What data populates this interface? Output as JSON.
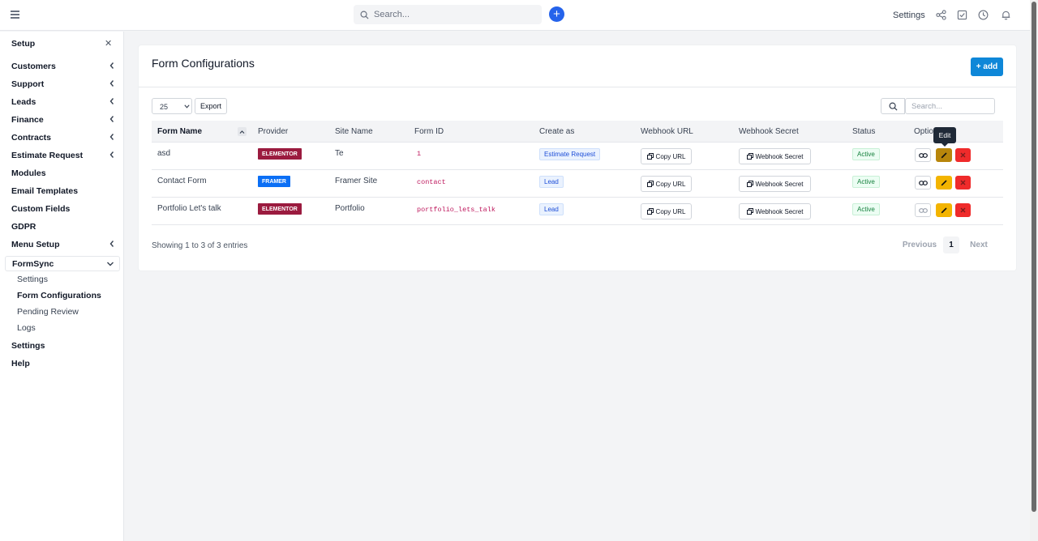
{
  "topbar": {
    "search_placeholder": "Search...",
    "settings_label": "Settings"
  },
  "sidebar": {
    "header": "Setup",
    "items": [
      {
        "label": "Customers",
        "chevron": true
      },
      {
        "label": "Support",
        "chevron": true
      },
      {
        "label": "Leads",
        "chevron": true
      },
      {
        "label": "Finance",
        "chevron": true
      },
      {
        "label": "Contracts",
        "chevron": true
      },
      {
        "label": "Estimate Request",
        "chevron": true
      },
      {
        "label": "Modules",
        "chevron": false
      },
      {
        "label": "Email Templates",
        "chevron": false
      },
      {
        "label": "Custom Fields",
        "chevron": false
      },
      {
        "label": "GDPR",
        "chevron": false
      },
      {
        "label": "Menu Setup",
        "chevron": true
      }
    ],
    "active_group": "FormSync",
    "sub_items": [
      "Settings",
      "Form Configurations",
      "Pending Review",
      "Logs"
    ],
    "bottom_items": [
      "Settings",
      "Help"
    ]
  },
  "page": {
    "title": "Form Configurations",
    "add_label": "add",
    "page_length": "25",
    "export_label": "Export",
    "search_placeholder": "Search...",
    "showing_text": "Showing 1 to 3 of 3 entries",
    "pagination": {
      "previous": "Previous",
      "current": "1",
      "next": "Next"
    },
    "tooltip": "Edit"
  },
  "table": {
    "columns": [
      "Form Name",
      "Provider",
      "Site Name",
      "Form ID",
      "Create as",
      "Webhook URL",
      "Webhook Secret",
      "Status",
      "Options"
    ],
    "copy_url_label": "Copy URL",
    "webhook_secret_label": "Webhook Secret",
    "rows": [
      {
        "form_name": "asd",
        "provider": "ELEMENTOR",
        "provider_color": "#9b1b3f",
        "site_name": "Te",
        "form_id": "1",
        "create_as": "Estimate Request",
        "status": "Active"
      },
      {
        "form_name": "Contact Form",
        "provider": "FRAMER",
        "provider_color": "#0b6ff5",
        "site_name": "Framer Site",
        "form_id": "contact",
        "create_as": "Lead",
        "status": "Active"
      },
      {
        "form_name": "Portfolio Let's talk",
        "provider": "ELEMENTOR",
        "provider_color": "#9b1b3f",
        "site_name": "Portfolio",
        "form_id": "portfolio_lets_talk",
        "create_as": "Lead",
        "status": "Active"
      }
    ]
  }
}
